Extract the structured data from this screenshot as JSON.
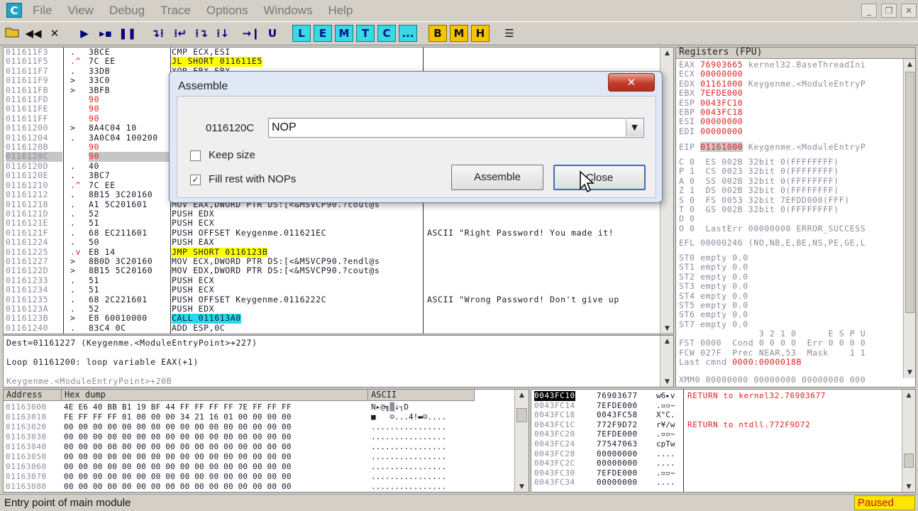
{
  "app": {
    "icon_letter": "C"
  },
  "menu": [
    "File",
    "View",
    "Debug",
    "Trace",
    "Options",
    "Windows",
    "Help"
  ],
  "window_controls": {
    "min": "_",
    "max": "❐",
    "close": "✕"
  },
  "toolbar": {
    "nav_icons": [
      "open-icon",
      "rewind-icon",
      "close-icon",
      "run-icon",
      "pause-step-icon",
      "pause-icon",
      "step-into-icon",
      "step-over-icon",
      "trace-into-icon",
      "trace-over-icon",
      "execute-till-return-icon",
      "execute-till-user-code-icon"
    ],
    "cyan_labels": [
      "L",
      "E",
      "M",
      "T",
      "C",
      "..."
    ],
    "yellow_labels": [
      "B",
      "M",
      "H"
    ]
  },
  "disasm": {
    "addresses": [
      "011611F3",
      "011611F5",
      "011611F7",
      "011611F9",
      "011611FB",
      "011611FD",
      "011611FE",
      "011611FF",
      "01161200",
      "01161204",
      "0116120B",
      "0116120C",
      "0116120D",
      "0116120E",
      "01161210",
      "01161212",
      "01161218",
      "0116121D",
      "0116121E",
      "0116121F",
      "01161224",
      "01161225",
      "01161227",
      "0116122D",
      "01161233",
      "01161234",
      "01161235",
      "0116123A",
      "0116123B",
      "01161240"
    ],
    "marks": [
      ".",
      ".^",
      ".",
      ">",
      ">",
      "",
      "",
      "",
      ">",
      ".",
      "",
      "",
      ".",
      ".",
      ".^",
      ".",
      ".",
      ".",
      ".",
      ".",
      ".",
      ".v",
      ">",
      ">",
      ".",
      ".",
      ".",
      ".",
      ">",
      "."
    ],
    "hex": [
      "3BCE",
      "7C EE",
      "33DB",
      "33C0",
      "3BFB",
      "90",
      "90",
      "90",
      "8A4C04 10",
      "3A0C04 100200",
      "90",
      "90",
      "40",
      "3BC7",
      "7C EE",
      "8B15 3C20160",
      "A1 5C201601",
      "52",
      "51",
      "68 EC211601",
      "50",
      "EB 14",
      "8B0D 3C20160",
      "8B15 5C20160",
      "51",
      "51",
      "68 2C221601",
      "52",
      "E8 60010000",
      "83C4 0C"
    ],
    "asm": [
      "CMP ECX,ESI",
      "JL SHORT 011611E5",
      "XOR EBX,EBX",
      "",
      "",
      "",
      "",
      "",
      "",
      "",
      "",
      "",
      "",
      "",
      "",
      "",
      "MOV EAX,DWORD PTR DS:[<&MSVCP90.?cout@s",
      "PUSH EDX",
      "PUSH ECX",
      "PUSH OFFSET Keygenme.011621EC",
      "PUSH EAX",
      "JMP SHORT 0116123B",
      "MOV ECX,DWORD PTR DS:[<&MSVCP90.?endl@s",
      "MOV EDX,DWORD PTR DS:[<&MSVCP90.?cout@s",
      "PUSH ECX",
      "PUSH ECX",
      "PUSH OFFSET Keygenme.0116222C",
      "PUSH EDX",
      "CALL 011613A0",
      "ADD ESP,0C"
    ],
    "comments": [
      "",
      "",
      "",
      "",
      "",
      "",
      "",
      "",
      "",
      "",
      "",
      "",
      "",
      "",
      "",
      "",
      "",
      "",
      "",
      "ASCII \"Right Password! You made it!",
      "",
      "",
      "",
      "",
      "",
      "",
      "ASCII \"Wrong Password! Don't give up",
      "",
      "",
      ""
    ]
  },
  "info": {
    "line1": "Dest=01161227 (Keygenme.<ModuleEntryPoint>+227)",
    "line2": "Loop 01161200: loop variable EAX(+1)",
    "line3": "Keygenme.<ModuleEntryPoint>+20B"
  },
  "registers": {
    "title": "Registers (FPU)",
    "gp": [
      {
        "name": "EAX",
        "value": "76903665",
        "comment": "kernel32.BaseThreadIni"
      },
      {
        "name": "ECX",
        "value": "00000000",
        "comment": ""
      },
      {
        "name": "EDX",
        "value": "01161000",
        "comment": "Keygenme.<ModuleEntryP"
      },
      {
        "name": "EBX",
        "value": "7EFDE000",
        "comment": ""
      },
      {
        "name": "ESP",
        "value": "0043FC10",
        "comment": ""
      },
      {
        "name": "EBP",
        "value": "0043FC18",
        "comment": ""
      },
      {
        "name": "ESI",
        "value": "00000000",
        "comment": ""
      },
      {
        "name": "EDI",
        "value": "00000000",
        "comment": ""
      }
    ],
    "eip": {
      "name": "EIP",
      "value": "01161000",
      "comment": "Keygenme.<ModuleEntryP"
    },
    "flags": [
      "C 0  ES 002B 32bit 0(FFFFFFFF)",
      "P 1  CS 0023 32bit 0(FFFFFFFF)",
      "A 0  SS 002B 32bit 0(FFFFFFFF)",
      "Z 1  DS 002B 32bit 0(FFFFFFFF)",
      "S 0  FS 0053 32bit 7EFDD000(FFF)",
      "T 0  GS 002B 32bit 0(FFFFFFFF)",
      "D 0",
      "O 0  LastErr 00000000 ERROR_SUCCESS"
    ],
    "efl": "EFL 00000246 (NO,NB,E,BE,NS,PE,GE,L",
    "st": [
      "ST0 empty 0.0",
      "ST1 empty 0.0",
      "ST2 empty 0.0",
      "ST3 empty 0.0",
      "ST4 empty 0.0",
      "ST5 empty 0.0",
      "ST6 empty 0.0",
      "ST7 empty 0.0"
    ],
    "fpu": [
      "               3 2 1 0      E S P U",
      "FST 0000  Cond 0 0 0 0  Err 0 0 0 0",
      "FCW 027F  Prec NEAR,53  Mask    1 1",
      "Last cmnd 0000:0000018B"
    ],
    "xmm": "XMM0 00000000 00000000 00000000 000"
  },
  "dump": {
    "headers": {
      "address": "Address",
      "hex": "Hex dump",
      "ascii": "ASCII"
    },
    "rows": [
      {
        "addr": "01163000",
        "hex": "4E E6 40 BB B1 19 BF 44 FF FF FF FF 7E FF FF FF",
        "ascii": "N▸@╗▒↓┐D        "
      },
      {
        "addr": "01163010",
        "hex": "FE FF FF FF 01 00 00 00 34 21 16 01 00 00 00 00",
        "ascii": "■   ☺...4!▬☺....   "
      },
      {
        "addr": "01163020",
        "hex": "00 00 00 00 00 00 00 00 00 00 00 00 00 00 00 00",
        "ascii": "................"
      },
      {
        "addr": "01163030",
        "hex": "00 00 00 00 00 00 00 00 00 00 00 00 00 00 00 00",
        "ascii": "................"
      },
      {
        "addr": "01163040",
        "hex": "00 00 00 00 00 00 00 00 00 00 00 00 00 00 00 00",
        "ascii": "................"
      },
      {
        "addr": "01163050",
        "hex": "00 00 00 00 00 00 00 00 00 00 00 00 00 00 00 00",
        "ascii": "................"
      },
      {
        "addr": "01163060",
        "hex": "00 00 00 00 00 00 00 00 00 00 00 00 00 00 00 00",
        "ascii": "................"
      },
      {
        "addr": "01163070",
        "hex": "00 00 00 00 00 00 00 00 00 00 00 00 00 00 00 00",
        "ascii": "................"
      },
      {
        "addr": "01163080",
        "hex": "00 00 00 00 00 00 00 00 00 00 00 00 00 00 00 00",
        "ascii": "................"
      }
    ]
  },
  "stack": {
    "rows": [
      {
        "addr": "0043FC10",
        "val": "76903677",
        "asc": "w6▸v",
        "comment": "RETURN to kernel32.76903677"
      },
      {
        "addr": "0043FC14",
        "val": "7EFDE000",
        "asc": ".▫▫~",
        "comment": ""
      },
      {
        "addr": "0043FC18",
        "val": "0043FC58",
        "asc": "X°C.",
        "comment": ""
      },
      {
        "addr": "0043FC1C",
        "val": "772F9D72",
        "asc": "r¥/w",
        "comment": "RETURN to ntdll.772F9D72"
      },
      {
        "addr": "0043FC20",
        "val": "7EFDE000",
        "asc": ".▫▫~",
        "comment": ""
      },
      {
        "addr": "0043FC24",
        "val": "77547063",
        "asc": "cpTw",
        "comment": ""
      },
      {
        "addr": "0043FC28",
        "val": "00000000",
        "asc": "....",
        "comment": ""
      },
      {
        "addr": "0043FC2C",
        "val": "00000000",
        "asc": "....",
        "comment": ""
      },
      {
        "addr": "0043FC30",
        "val": "7EFDE000",
        "asc": ".▫▫~",
        "comment": ""
      },
      {
        "addr": "0043FC34",
        "val": "00000000",
        "asc": "....",
        "comment": ""
      }
    ]
  },
  "dialog": {
    "title": "Assemble",
    "address": "0116120C",
    "input_value": "NOP",
    "keep_size_label": "Keep size",
    "keep_size_checked": false,
    "fill_nops_label": "Fill rest with NOPs",
    "fill_nops_checked": true,
    "assemble_button": "Assemble",
    "close_button": "Close"
  },
  "status": {
    "text": "Entry point of main module",
    "state": "Paused"
  }
}
